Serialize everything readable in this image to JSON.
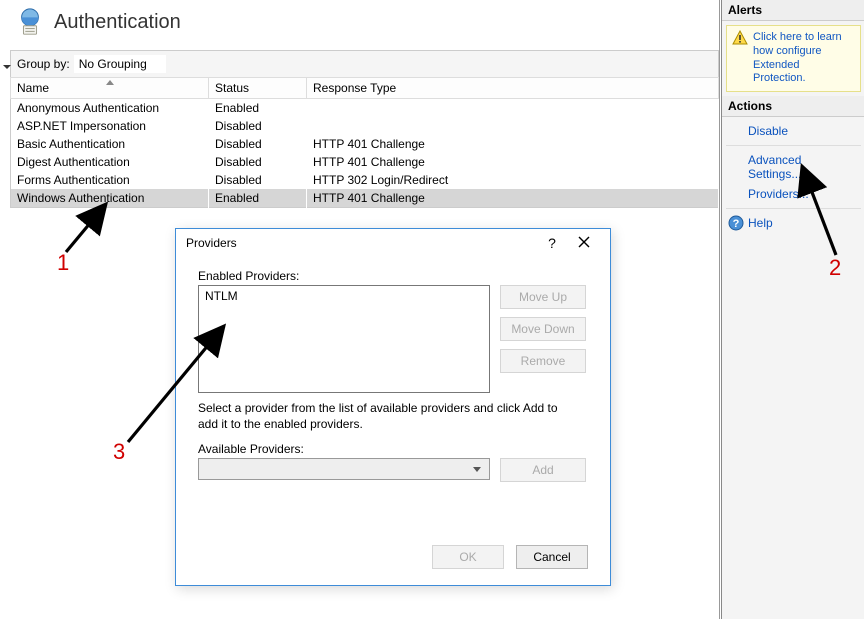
{
  "header": {
    "title": "Authentication"
  },
  "groupby": {
    "label": "Group by:",
    "value": "No Grouping"
  },
  "grid": {
    "columns": [
      "Name",
      "Status",
      "Response Type"
    ],
    "rows": [
      {
        "name": "Anonymous Authentication",
        "status": "Enabled",
        "response": "",
        "selected": false
      },
      {
        "name": "ASP.NET Impersonation",
        "status": "Disabled",
        "response": "",
        "selected": false
      },
      {
        "name": "Basic Authentication",
        "status": "Disabled",
        "response": "HTTP 401 Challenge",
        "selected": false
      },
      {
        "name": "Digest Authentication",
        "status": "Disabled",
        "response": "HTTP 401 Challenge",
        "selected": false
      },
      {
        "name": "Forms Authentication",
        "status": "Disabled",
        "response": "HTTP 302 Login/Redirect",
        "selected": false
      },
      {
        "name": "Windows Authentication",
        "status": "Enabled",
        "response": "HTTP 401 Challenge",
        "selected": true
      }
    ]
  },
  "right": {
    "alerts_header": "Alerts",
    "alert_text": "Click here to learn how configure Extended Protection.",
    "actions_header": "Actions",
    "links": {
      "disable": "Disable",
      "advanced": "Advanced Settings...",
      "providers": "Providers...",
      "help": "Help"
    }
  },
  "dialog": {
    "title": "Providers",
    "enabled_label": "Enabled Providers:",
    "enabled_items": [
      "NTLM"
    ],
    "moveup": "Move Up",
    "movedown": "Move Down",
    "remove": "Remove",
    "instruction": "Select a provider from the list of available providers and click Add to add it to the enabled providers.",
    "available_label": "Available Providers:",
    "add": "Add",
    "ok": "OK",
    "cancel": "Cancel"
  },
  "annotations": {
    "n1": "1",
    "n2": "2",
    "n3": "3"
  }
}
